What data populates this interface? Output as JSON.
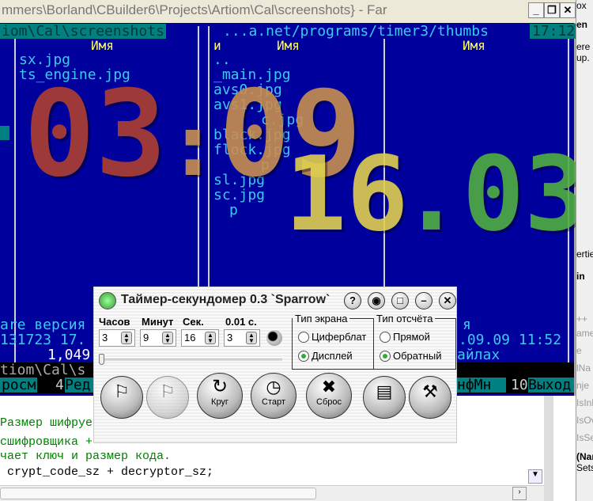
{
  "far": {
    "title": "mmers\\Borland\\CBuilder6\\Projects\\Artiom\\Cal\\screenshots} - Far",
    "left_path": "iom\\Cal\\screenshots",
    "right_path": "...a.net/programs/timer3/thumbs",
    "clock": "17:12",
    "col_header": "Имя",
    "right_col_prefix": "и",
    "left_files": [
      "sx.jpg",
      "ts_engine.jpg"
    ],
    "right_files": [
      "..",
      "_main.jpg",
      "avs0.jpg",
      "avs1.jpg",
      "c.jpg",
      "black.jpg",
      "flock.jpg",
      "p",
      "sl.jpg",
      "sc.jpg",
      "p"
    ],
    "status_left_1": "are версия",
    "status_left_2": "131723 17.",
    "status_left_3": "1,049",
    "status_right_2": ".09.09 11:52",
    "status_right_3": "айлах",
    "status_right_1": "я",
    "cmdline": "tiom\\Cal\\s",
    "keybar": [
      {
        "num": "",
        "label": "росм"
      },
      {
        "num": "4",
        "label": "Ред"
      },
      {
        "num": "",
        "label": "нфМн"
      },
      {
        "num": "10",
        "label": "Выход"
      }
    ]
  },
  "big_clock": {
    "hours": "03",
    "minutes": "09",
    "seconds": "16",
    "hundredths": "03",
    "colors": {
      "hours": "#b04030",
      "minutes": "#c89050",
      "seconds": "#e0d050",
      "hundredths": "#50b040"
    }
  },
  "editor": {
    "lines": [
      "Размер шифрует",
      "сшифровщика +",
      "чает ключ и размер кода.",
      " crypt_code_sz + decryptor_sz;"
    ]
  },
  "right_pane": {
    "items": [
      "ox",
      "en",
      "ere",
      "up.",
      "ertie",
      "in",
      "++",
      "ame",
      "e",
      "lNa",
      "nje",
      "IsInlin",
      "IsOve",
      "IsSea",
      "(Name)",
      "Sets/retu"
    ]
  },
  "timer": {
    "title": "Таймер-секундомер 0.3 `Sparrow`",
    "fields": [
      {
        "label": "Часов",
        "value": "3"
      },
      {
        "label": "Минут",
        "value": "9"
      },
      {
        "label": "Сек.",
        "value": "16"
      },
      {
        "label": "0.01 с.",
        "value": "3"
      }
    ],
    "screen_type": {
      "label": "Тип экрана",
      "options": [
        "Циферблат",
        "Дисплей"
      ],
      "selected": "Дисплей"
    },
    "count_type": {
      "label": "Тип отсчёта",
      "options": [
        "Прямой",
        "Обратный"
      ],
      "selected": "Обратный"
    },
    "slider_value": 0,
    "buttons": {
      "lap": "Круг",
      "start": "Старт",
      "reset": "Сброс"
    }
  }
}
